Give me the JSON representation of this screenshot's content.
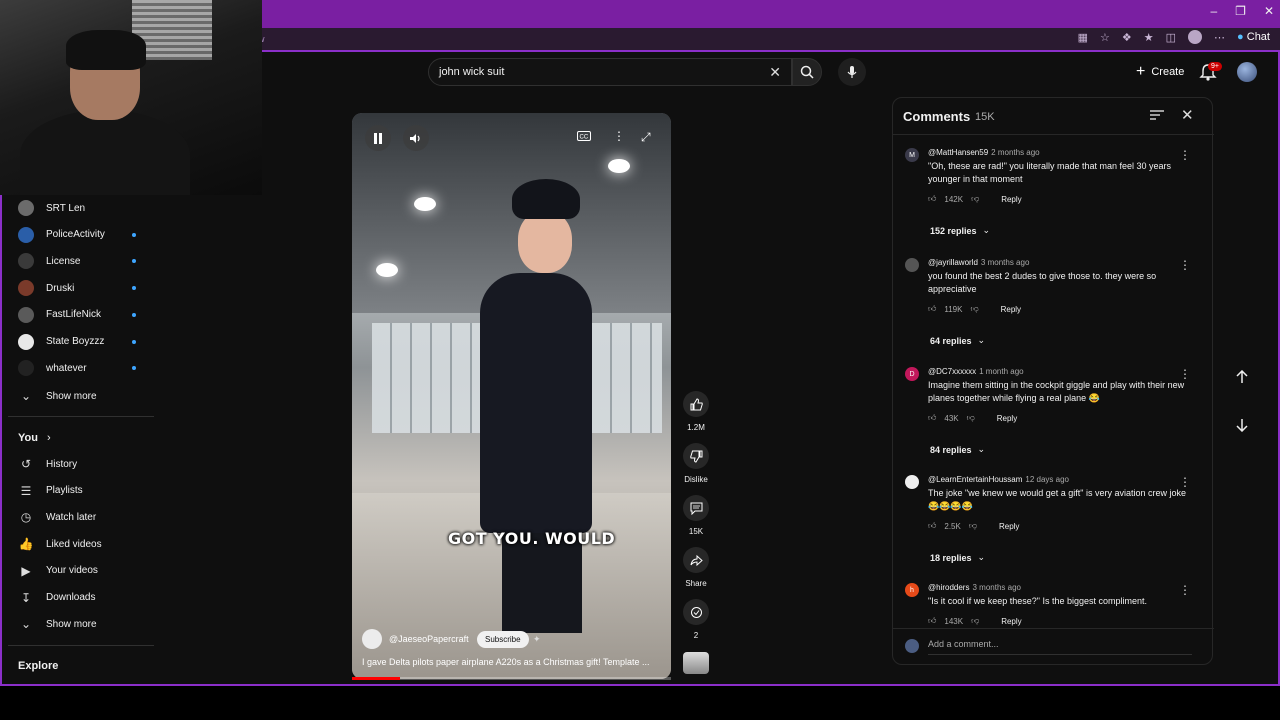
{
  "browser": {
    "chat_label": "Chat",
    "address_fragment": "w"
  },
  "search": {
    "query": "john wick suit"
  },
  "header": {
    "create_label": "Create",
    "notification_badge": "9+"
  },
  "sidebar": {
    "subscriptions": [
      {
        "label": "SRT Len",
        "color": "#6b6b6b",
        "dot": false
      },
      {
        "label": "PoliceActivity",
        "color": "#2a5ea8",
        "dot": true
      },
      {
        "label": "License",
        "color": "#3a3a3a",
        "dot": true
      },
      {
        "label": "Druski",
        "color": "#7a3a2a",
        "dot": true
      },
      {
        "label": "FastLifeNick",
        "color": "#5a5a5a",
        "dot": true
      },
      {
        "label": "State Boyzzz",
        "color": "#e8e8e8",
        "dot": true
      },
      {
        "label": "whatever",
        "color": "#222222",
        "dot": true
      }
    ],
    "show_more_1": "Show more",
    "you_heading": "You",
    "you_items": [
      {
        "label": "History",
        "icon": "history-icon"
      },
      {
        "label": "Playlists",
        "icon": "playlists-icon"
      },
      {
        "label": "Watch later",
        "icon": "watch-later-icon"
      },
      {
        "label": "Liked videos",
        "icon": "liked-videos-icon"
      },
      {
        "label": "Your videos",
        "icon": "your-videos-icon"
      },
      {
        "label": "Downloads",
        "icon": "downloads-icon"
      }
    ],
    "show_more_2": "Show more",
    "explore_heading": "Explore"
  },
  "video": {
    "caption": "GOT YOU. WOULD",
    "channel": "@JaeseoPapercraft",
    "subscribe_label": "Subscribe",
    "title": "I gave Delta pilots paper airplane A220s as a Christmas gift! Template ...",
    "progress_fraction": 0.15
  },
  "actions": {
    "likes": "1.2M",
    "dislike_label": "Dislike",
    "comments": "15K",
    "share_label": "Share",
    "remix_count": "2"
  },
  "comments_panel": {
    "title": "Comments",
    "count": "15K",
    "add_placeholder": "Add a comment...",
    "comments": [
      {
        "author": "@MattHansen59",
        "time": "2 months ago",
        "text": "\"Oh, these are rad!\" you literally made that man feel 30 years younger in that moment",
        "likes": "142K",
        "reply": "Reply",
        "replies": "152 replies",
        "avatar_letter": "M",
        "avatar_color": "#3a3a4a"
      },
      {
        "author": "@jayrillaworld",
        "time": "3 months ago",
        "text": "you found the best 2 dudes to give those to. they were so appreciative",
        "likes": "119K",
        "reply": "Reply",
        "replies": "64 replies",
        "avatar_letter": "",
        "avatar_color": "#555555"
      },
      {
        "author": "@DC7xxxxxx",
        "time": "1 month ago",
        "text": "Imagine them sitting in the cockpit giggle and play with their new planes together while flying a real plane 😂",
        "likes": "43K",
        "reply": "Reply",
        "replies": "84 replies",
        "avatar_letter": "D",
        "avatar_color": "#c2185b"
      },
      {
        "author": "@LearnEntertainHoussam",
        "time": "12 days ago",
        "text": "The joke \"we knew we would get a gift\" is very aviation crew joke 😂😂😂😂",
        "likes": "2.5K",
        "reply": "Reply",
        "replies": "18 replies",
        "avatar_letter": "",
        "avatar_color": "#eeeeee"
      },
      {
        "author": "@hirodders",
        "time": "3 months ago",
        "text": "\"Is it cool if we keep these?\" Is the biggest compliment.",
        "likes": "143K",
        "reply": "Reply",
        "replies": "",
        "avatar_letter": "h",
        "avatar_color": "#e64a19"
      }
    ]
  },
  "colors": {
    "accent_border": "#8b2fc9",
    "titlebar": "#7a1fa2",
    "progress": "#ff0000",
    "notification": "#cc0000",
    "subscription_dot": "#3ea6ff"
  }
}
